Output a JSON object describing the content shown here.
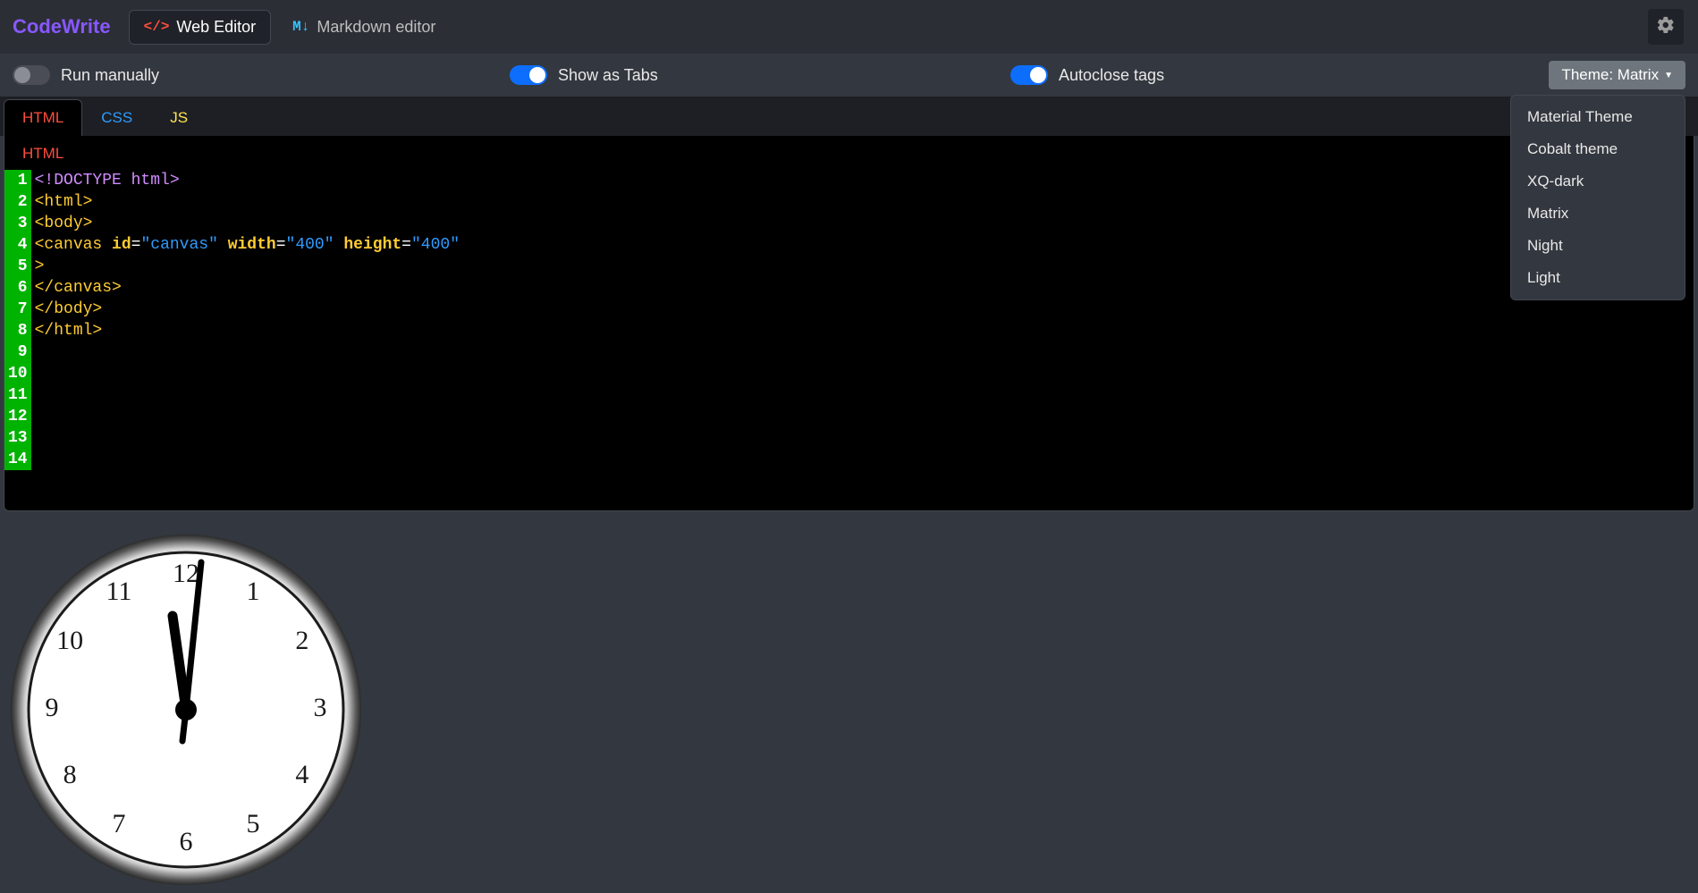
{
  "brand": "CodeWrite",
  "nav": {
    "web_editor": "Web Editor",
    "md_editor": "Markdown editor"
  },
  "options": {
    "run_manually": "Run manually",
    "show_as_tabs": "Show as Tabs",
    "autoclose_tags": "Autoclose tags",
    "theme_button": "Theme: Matrix"
  },
  "theme_menu": {
    "items": [
      "Material Theme",
      "Cobalt theme",
      "XQ-dark",
      "Matrix",
      "Night",
      "Light"
    ]
  },
  "editor_tabs": {
    "html": "HTML",
    "css": "CSS",
    "js": "JS"
  },
  "pane_label": "HTML",
  "code_lines": 14,
  "code": {
    "l1_doctype": "<!DOCTYPE html>",
    "l2_open_html": "<html>",
    "l3_open_body": "<body>",
    "l4_canvas_tag": "canvas",
    "l4_id_attr": "id",
    "l4_id_val": "\"canvas\"",
    "l4_w_attr": "width",
    "l4_w_val": "\"400\"",
    "l4_h_attr": "height",
    "l4_h_val": "\"400\"",
    "l5": ">",
    "l6_close_canvas": "</canvas>",
    "l7_close_body": "</body>",
    "l8_close_html": "</html>"
  },
  "clock": {
    "numerals": [
      "12",
      "1",
      "2",
      "3",
      "4",
      "5",
      "6",
      "7",
      "8",
      "9",
      "10",
      "11"
    ]
  }
}
